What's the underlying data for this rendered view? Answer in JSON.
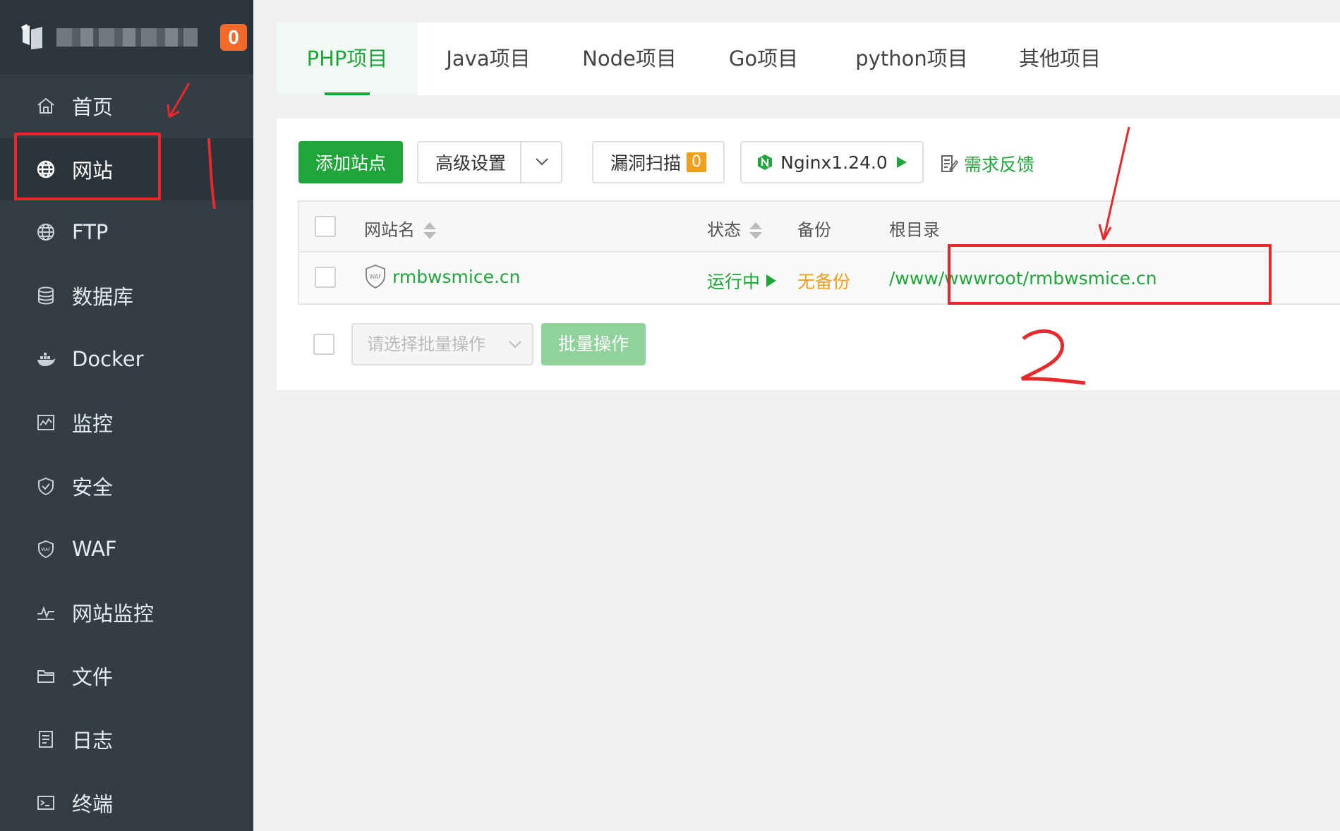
{
  "sidebar": {
    "badge": "0",
    "items": [
      {
        "label": "首页",
        "icon": "home-icon"
      },
      {
        "label": "网站",
        "icon": "globe-icon",
        "active": true
      },
      {
        "label": "FTP",
        "icon": "ftp-icon"
      },
      {
        "label": "数据库",
        "icon": "database-icon"
      },
      {
        "label": "Docker",
        "icon": "docker-icon"
      },
      {
        "label": "监控",
        "icon": "monitor-icon"
      },
      {
        "label": "安全",
        "icon": "shield-icon"
      },
      {
        "label": "WAF",
        "icon": "waf-icon"
      },
      {
        "label": "网站监控",
        "icon": "pulse-icon"
      },
      {
        "label": "文件",
        "icon": "folder-icon"
      },
      {
        "label": "日志",
        "icon": "log-icon"
      },
      {
        "label": "终端",
        "icon": "terminal-icon"
      }
    ]
  },
  "tabs": [
    {
      "label": "PHP项目",
      "active": true
    },
    {
      "label": "Java项目"
    },
    {
      "label": "Node项目"
    },
    {
      "label": "Go项目"
    },
    {
      "label": "python项目"
    },
    {
      "label": "其他项目"
    }
  ],
  "toolbar": {
    "add_site": "添加站点",
    "advanced": "高级设置",
    "vuln_scan": "漏洞扫描",
    "vuln_count": "0",
    "nginx": "Nginx1.24.0",
    "feedback": "需求反馈"
  },
  "table": {
    "headers": {
      "name": "网站名",
      "status": "状态",
      "backup": "备份",
      "root": "根目录"
    },
    "rows": [
      {
        "name": "rmbwsmice.cn",
        "status": "运行中",
        "backup": "无备份",
        "root": "/www/wwwroot/rmbwsmice.cn"
      }
    ]
  },
  "batch": {
    "placeholder": "请选择批量操作",
    "button": "批量操作"
  },
  "colors": {
    "accent": "#20a53a",
    "sidebar": "#333d45",
    "warn": "#f0a020",
    "annotation": "#e8292c"
  }
}
